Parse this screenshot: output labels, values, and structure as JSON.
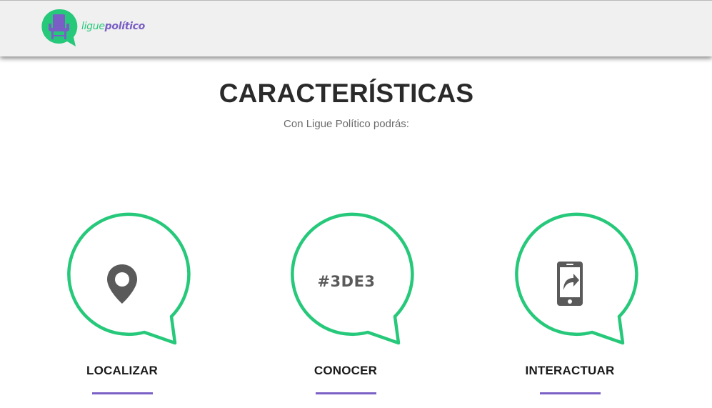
{
  "header": {
    "logo_text_part1": "ligue",
    "logo_text_part2": "político",
    "logo_icon": "speech-bubble-chair-icon"
  },
  "section": {
    "title": "CARACTERÍSTICAS",
    "subtitle": "Con Ligue Político podrás:"
  },
  "features": [
    {
      "label": "LOCALIZAR",
      "icon": "location-pin-icon"
    },
    {
      "label": "CONOCER",
      "icon_text": "#3DE3"
    },
    {
      "label": "INTERACTUAR",
      "icon": "smartphone-share-icon"
    }
  ],
  "colors": {
    "accent_green": "#26c87a",
    "accent_purple": "#7b60c6",
    "icon_gray": "#5a5a5a",
    "header_bg": "#f0f0f0"
  }
}
